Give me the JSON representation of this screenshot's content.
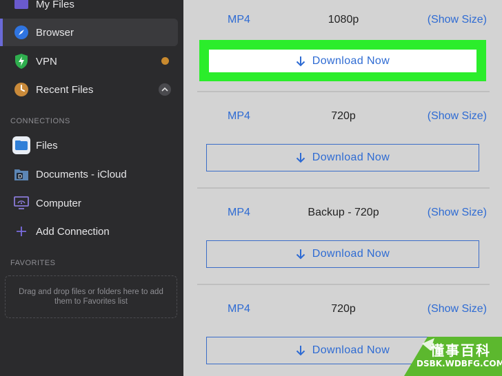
{
  "sidebar": {
    "items": [
      {
        "label": "My Files",
        "icon": "folder-icon"
      },
      {
        "label": "Browser",
        "icon": "compass-icon",
        "active": true
      },
      {
        "label": "VPN",
        "icon": "shield-icon"
      },
      {
        "label": "Recent Files",
        "icon": "clock-icon"
      }
    ],
    "connections_heading": "CONNECTIONS",
    "connections": [
      {
        "label": "Files",
        "icon": "files-app-icon"
      },
      {
        "label": "Documents - iCloud",
        "icon": "documents-folder-icon"
      },
      {
        "label": "Computer",
        "icon": "computer-icon"
      },
      {
        "label": "Add Connection",
        "icon": "plus-icon"
      }
    ],
    "favorites_heading": "FAVORITES",
    "favorites_hint": "Drag and drop files or folders here to add them to Favorites list"
  },
  "downloads": [
    {
      "format": "MP4",
      "resolution": "1080p",
      "size": "(Show Size)",
      "button": "Download Now"
    },
    {
      "format": "MP4",
      "resolution": "720p",
      "size": "(Show Size)",
      "button": "Download Now"
    },
    {
      "format": "MP4",
      "resolution": "Backup - 720p",
      "size": "(Show Size)",
      "button": "Download Now"
    },
    {
      "format": "MP4",
      "resolution": "720p",
      "size": "(Show Size)",
      "button": "Download Now"
    }
  ],
  "watermark": {
    "cn": "懂事百科",
    "en": "DSBK.WDBFG.COM"
  },
  "colors": {
    "accent": "#2e6bd3",
    "highlight": "#2bed2b",
    "sidebar_bg": "#2b2b2d",
    "main_bg": "#d3d3d3"
  }
}
